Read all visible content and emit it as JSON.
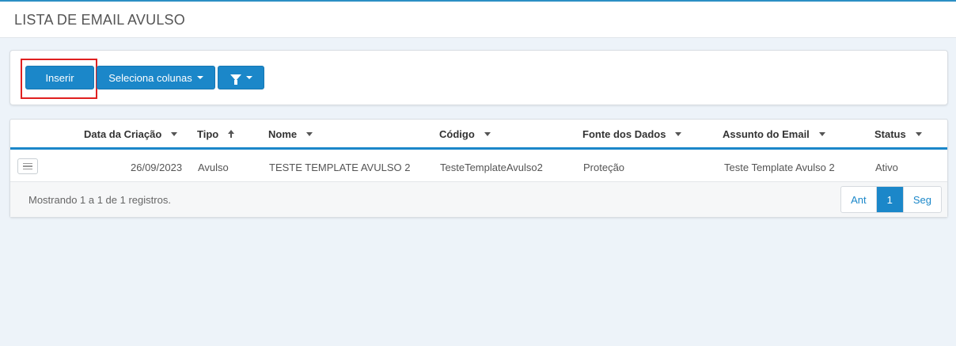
{
  "page": {
    "title": "LISTA DE EMAIL AVULSO"
  },
  "toolbar": {
    "insert_label": "Inserir",
    "columns_label": "Seleciona colunas",
    "filter_icon": "filter-icon"
  },
  "table": {
    "columns": [
      "Data da Criação",
      "Tipo",
      "Nome",
      "Código",
      "Fonte dos Dados",
      "Assunto do Email",
      "Status"
    ],
    "rows": [
      {
        "data_criacao": "26/09/2023",
        "tipo": "Avulso",
        "nome": "TESTE TEMPLATE AVULSO 2",
        "codigo": "TesteTemplateAvulso2",
        "fonte": "Proteção",
        "assunto": "Teste Template Avulso 2",
        "status": "Ativo"
      }
    ]
  },
  "footer": {
    "info": "Mostrando 1 a 1 de 1 registros.",
    "pagination": {
      "prev": "Ant",
      "current": "1",
      "next": "Seg"
    }
  },
  "colors": {
    "accent": "#1b87c9",
    "highlight": "#e02020",
    "background": "#edf3f9"
  }
}
